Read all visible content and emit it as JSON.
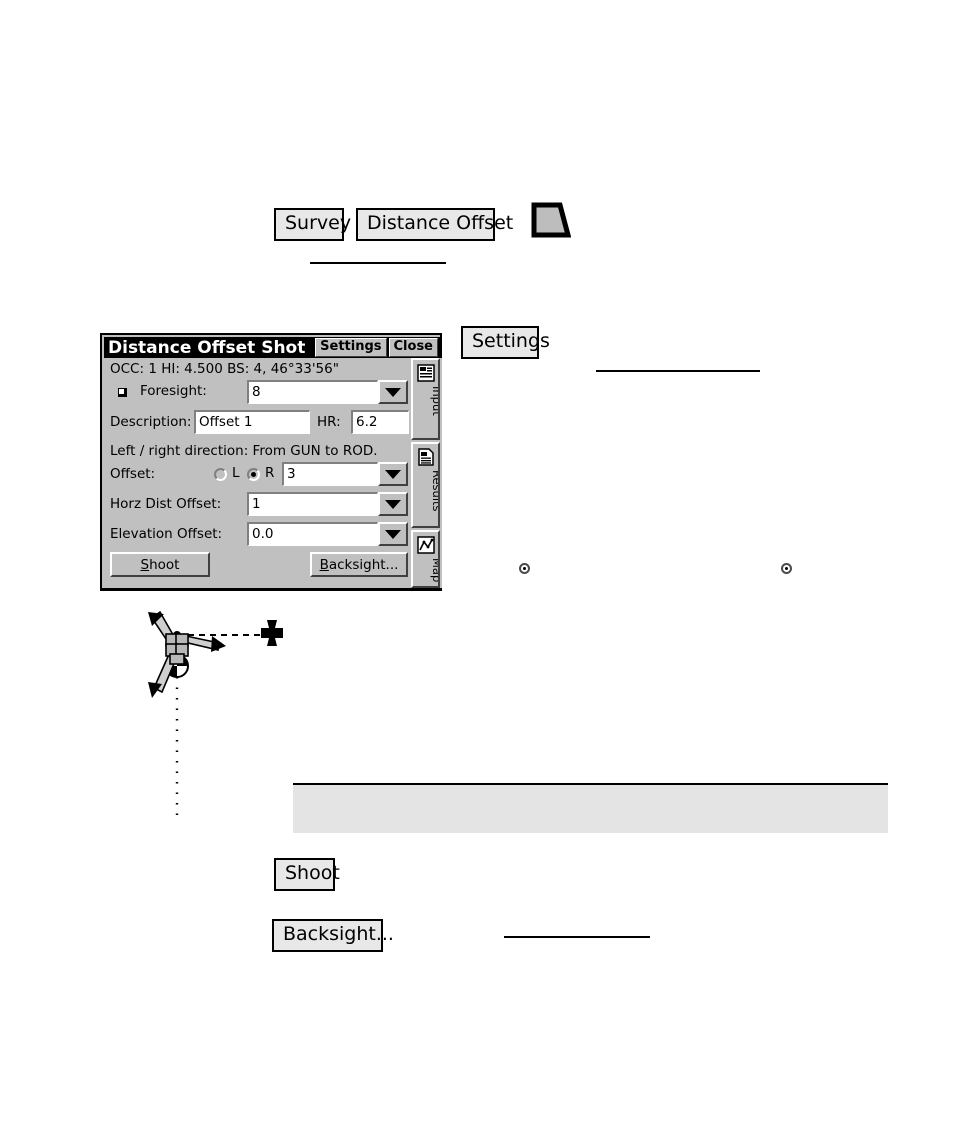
{
  "prose_keys": {
    "survey": "Survey",
    "distance_offset": "Distance Offset",
    "settings": "Settings",
    "shoot": "Shoot",
    "backsight": "Backsight..."
  },
  "icons": {
    "toolbar_shape": "trapezoid-icon",
    "input_tab": "input-form-icon",
    "results_tab": "results-document-icon",
    "map_tab": "map-icon",
    "prism_marker": "checkered-circle-prism-icon",
    "target_marker": "cross-target-icon",
    "instrument": "tripod-total-station-icon"
  },
  "dialog": {
    "title": "Distance Offset Shot",
    "settings_button": "Settings",
    "close_button": "Close",
    "status_line": "OCC: 1  HI: 4.500  BS: 4, 46°33'56\"",
    "foresight": {
      "label": "Foresight:",
      "value": "8",
      "dropdown": "chevron-down-icon"
    },
    "description": {
      "label": "Description:",
      "value": "Offset 1"
    },
    "hr": {
      "label": "HR:",
      "value": "6.2"
    },
    "direction_note": "Left / right direction:  From GUN to ROD.",
    "offset": {
      "label": "Offset:",
      "radio_left_label": "L",
      "radio_right_label": "R",
      "selected": "R",
      "value": "3"
    },
    "horz_dist_offset": {
      "label": "Horz Dist Offset:",
      "value": "1"
    },
    "elevation_offset": {
      "label": "Elevation Offset:",
      "value": "0.0"
    },
    "buttons": {
      "shoot": "Shoot",
      "shoot_accel": "S",
      "backsight": "Backsight...",
      "backsight_accel": "B"
    },
    "tabs": [
      {
        "label": "Input",
        "icon": "input-form-icon",
        "active": true
      },
      {
        "label": "Results",
        "icon": "results-document-icon",
        "active": false
      },
      {
        "label": "Map",
        "icon": "map-icon",
        "active": false
      }
    ]
  },
  "colors": {
    "window_face": "#c0c0c0",
    "titlebar": "#000000",
    "titlebar_text": "#ffffff",
    "field_bg": "#ffffff",
    "keycap_face": "#e8e8e8",
    "note_box": "#e4e4e4",
    "shadow": "#404040",
    "highlight": "#ffffff"
  }
}
